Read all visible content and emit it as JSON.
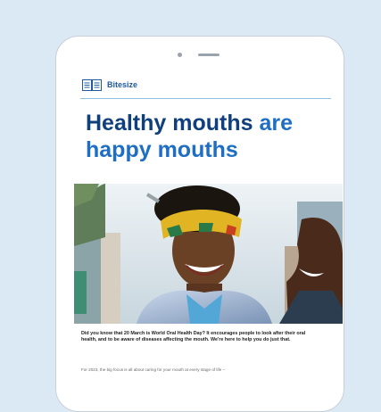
{
  "brand": {
    "name": "Bitesize",
    "icon": "book-icon"
  },
  "article": {
    "title_dark": "Healthy mouths",
    "title_accent": "are",
    "title_line2": "happy mouths",
    "intro": "Did you know that 20 March is World Oral Health Day? It encourages people to look after their oral health, and to be aware of diseases affecting the mouth. We're here to help you do just that.",
    "teaser": "For 2023, the big focus is all about caring for your mouth at every stage of life –"
  },
  "colors": {
    "background": "#dbe9f5",
    "title": "#0f3f7c",
    "accent": "#1e6fc3",
    "rule": "#8ec0e6"
  }
}
